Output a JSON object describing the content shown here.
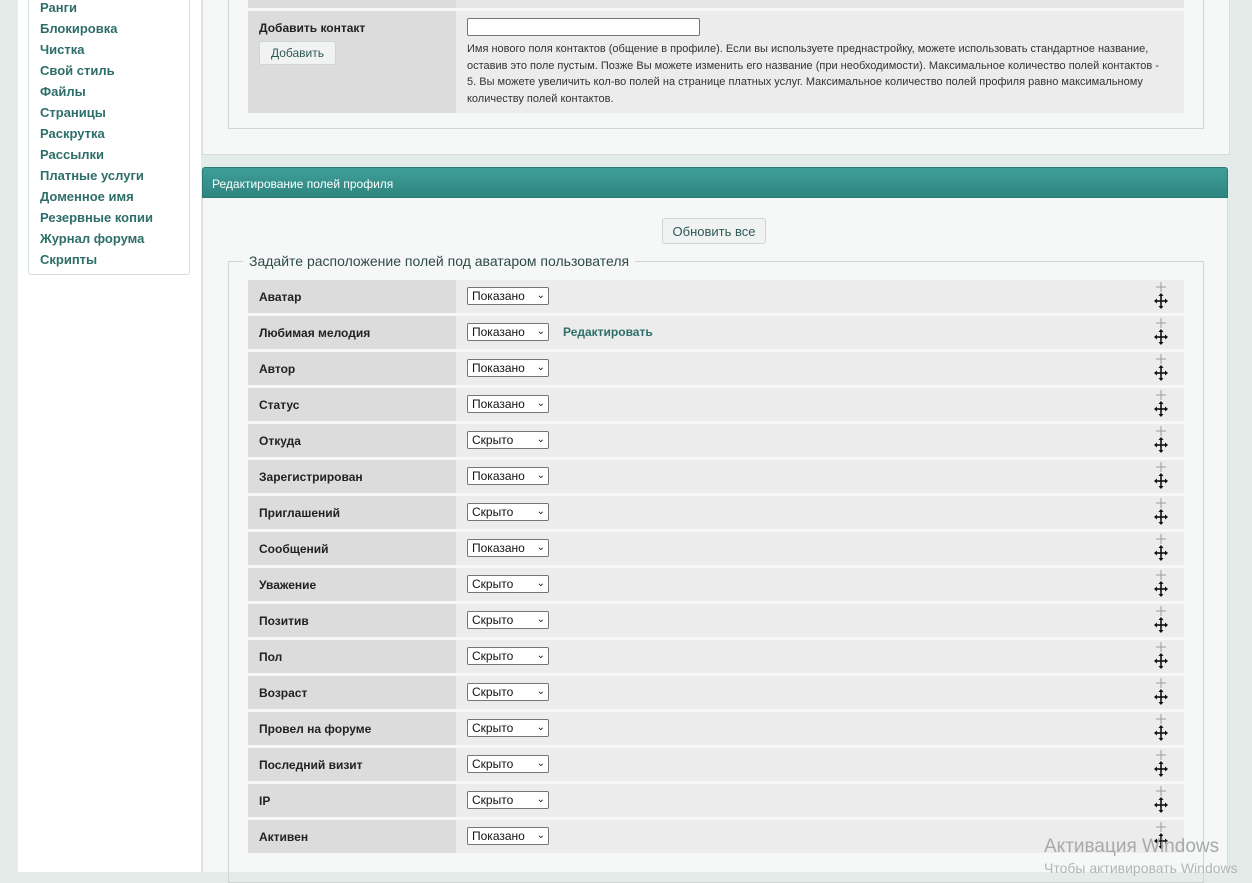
{
  "sidebar": {
    "items": [
      {
        "label": "Ранги"
      },
      {
        "label": "Блокировка"
      },
      {
        "label": "Чистка"
      },
      {
        "label": "Свой стиль"
      },
      {
        "label": "Файлы"
      },
      {
        "label": "Страницы"
      },
      {
        "label": "Раскрутка"
      },
      {
        "label": "Рассылки"
      },
      {
        "label": "Платные услуги"
      },
      {
        "label": "Доменное имя"
      },
      {
        "label": "Резервные копии"
      },
      {
        "label": "Журнал форума"
      },
      {
        "label": "Скрипты"
      }
    ]
  },
  "contacts": {
    "label": "Добавить контакт",
    "add_button": "Добавить",
    "input_value": "",
    "description": "Имя нового поля контактов (общение в профиле). Если вы используете преднастройку, можете использовать стандартное название, оставив это поле пустым. Позже Вы можете изменить его название (при необходимости). Максимальное количество полей контактов - 5. Вы можете увеличить кол-во полей на странице платных услуг. Максимальное количество полей профиля равно максимальному количеству полей контактов."
  },
  "profile_fields": {
    "header": "Редактирование полей профиля",
    "update_button": "Обновить все",
    "legend": "Задайте расположение полей под аватаром пользователя",
    "edit_link": "Редактировать",
    "rows": [
      {
        "name": "Аватар",
        "value": "Показано"
      },
      {
        "name": "Любимая мелодия",
        "value": "Показано",
        "edit": true
      },
      {
        "name": "Автор",
        "value": "Показано"
      },
      {
        "name": "Статус",
        "value": "Показано"
      },
      {
        "name": "Откуда",
        "value": "Скрыто"
      },
      {
        "name": "Зарегистрирован",
        "value": "Показано"
      },
      {
        "name": "Приглашений",
        "value": "Скрыто"
      },
      {
        "name": "Сообщений",
        "value": "Показано"
      },
      {
        "name": "Уважение",
        "value": "Скрыто"
      },
      {
        "name": "Позитив",
        "value": "Скрыто"
      },
      {
        "name": "Пол",
        "value": "Скрыто"
      },
      {
        "name": "Возраст",
        "value": "Скрыто"
      },
      {
        "name": "Провел на форуме",
        "value": "Скрыто"
      },
      {
        "name": "Последний визит",
        "value": "Скрыто"
      },
      {
        "name": "IP",
        "value": "Скрыто"
      },
      {
        "name": "Активен",
        "value": "Показано"
      }
    ]
  },
  "watermark": {
    "line1": "Активация Windows",
    "line2": "Чтобы активировать Windows"
  },
  "colors": {
    "accent": "#2e8f8a",
    "link": "#2e6e6a"
  }
}
